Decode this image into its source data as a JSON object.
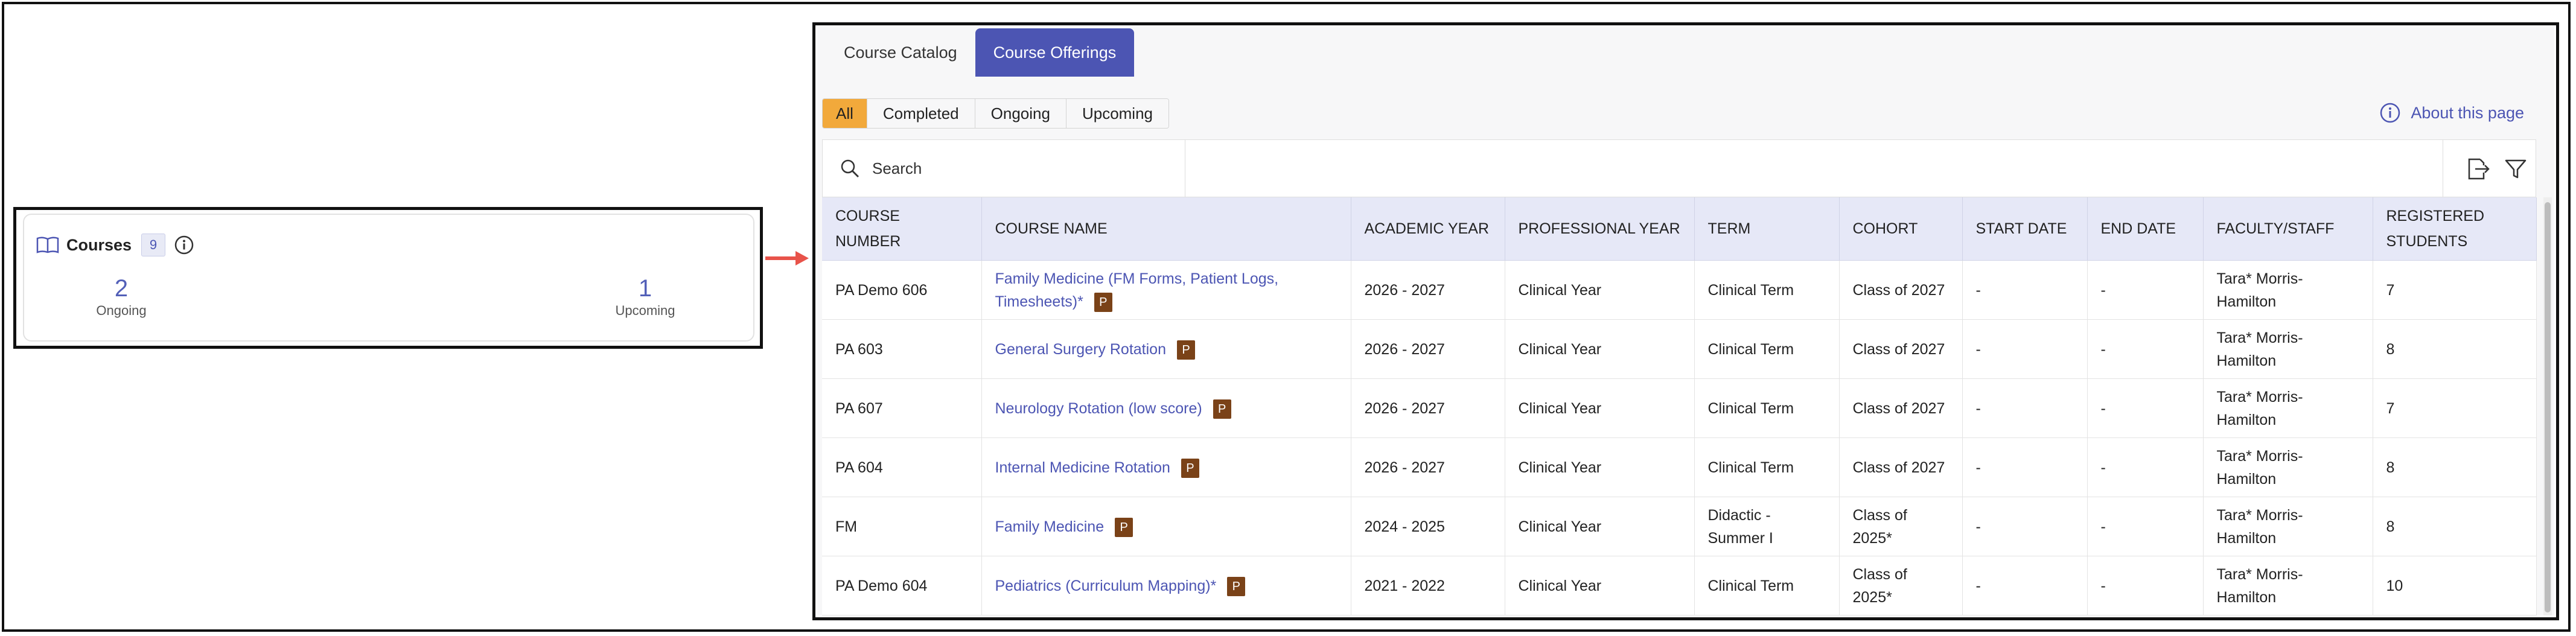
{
  "widget": {
    "title": "Courses",
    "count": "9",
    "stats": [
      {
        "value": "2",
        "label": "Ongoing"
      },
      {
        "value": "1",
        "label": "Upcoming"
      }
    ]
  },
  "tabs": [
    {
      "label": "Course Catalog",
      "active": false
    },
    {
      "label": "Course Offerings",
      "active": true
    }
  ],
  "filters": [
    {
      "label": "All",
      "active": true
    },
    {
      "label": "Completed",
      "active": false
    },
    {
      "label": "Ongoing",
      "active": false
    },
    {
      "label": "Upcoming",
      "active": false
    }
  ],
  "about_link": "About this page",
  "search": {
    "placeholder": "Search"
  },
  "table": {
    "columns": [
      "COURSE NUMBER",
      "COURSE NAME",
      "ACADEMIC YEAR",
      "PROFESSIONAL YEAR",
      "TERM",
      "COHORT",
      "START DATE",
      "END DATE",
      "FACULTY/STAFF",
      "REGISTERED STUDENTS"
    ],
    "badge_label": "P",
    "rows": [
      {
        "number": "PA Demo 606",
        "name": "Family Medicine (FM Forms, Patient Logs, Timesheets)*",
        "academic_year": "2026 - 2027",
        "professional_year": "Clinical Year",
        "term": "Clinical Term",
        "cohort": "Class of 2027",
        "start": "-",
        "end": "-",
        "faculty": "Tara* Morris-Hamilton",
        "students": "7"
      },
      {
        "number": "PA 603",
        "name": "General Surgery Rotation",
        "academic_year": "2026 - 2027",
        "professional_year": "Clinical Year",
        "term": "Clinical Term",
        "cohort": "Class of 2027",
        "start": "-",
        "end": "-",
        "faculty": "Tara* Morris-Hamilton",
        "students": "8"
      },
      {
        "number": "PA 607",
        "name": "Neurology Rotation (low score)",
        "academic_year": "2026 - 2027",
        "professional_year": "Clinical Year",
        "term": "Clinical Term",
        "cohort": "Class of 2027",
        "start": "-",
        "end": "-",
        "faculty": "Tara* Morris-Hamilton",
        "students": "7"
      },
      {
        "number": "PA 604",
        "name": "Internal Medicine Rotation",
        "academic_year": "2026 - 2027",
        "professional_year": "Clinical Year",
        "term": "Clinical Term",
        "cohort": "Class of 2027",
        "start": "-",
        "end": "-",
        "faculty": "Tara* Morris-Hamilton",
        "students": "8"
      },
      {
        "number": "FM",
        "name": "Family Medicine",
        "academic_year": "2024 - 2025",
        "professional_year": "Clinical Year",
        "term": "Didactic - Summer I",
        "cohort": "Class of 2025*",
        "start": "-",
        "end": "-",
        "faculty": "Tara* Morris-Hamilton",
        "students": "8"
      },
      {
        "number": "PA Demo 604",
        "name": "Pediatrics (Curriculum Mapping)*",
        "academic_year": "2021 - 2022",
        "professional_year": "Clinical Year",
        "term": "Clinical Term",
        "cohort": "Class of 2025*",
        "start": "-",
        "end": "-",
        "faculty": "Tara* Morris-Hamilton",
        "students": "10"
      }
    ]
  },
  "colors": {
    "accent": "#4c55b3",
    "filter_active": "#f2a93b",
    "badge": "#7a4218",
    "arrow": "#e8534a"
  }
}
